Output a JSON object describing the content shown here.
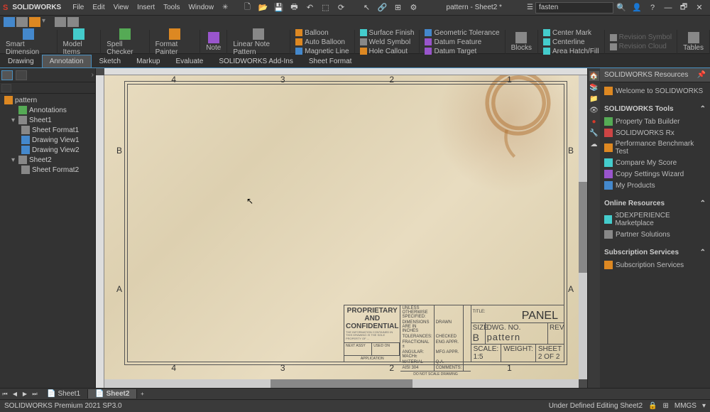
{
  "title": {
    "app": "SOLIDWORKS",
    "doc": "pattern - Sheet2 *"
  },
  "search": {
    "placeholder": "fasten"
  },
  "menu": [
    "File",
    "Edit",
    "View",
    "Insert",
    "Tools",
    "Window"
  ],
  "tabs": [
    "Drawing",
    "Annotation",
    "Sketch",
    "Markup",
    "Evaluate",
    "SOLIDWORKS Add-Ins",
    "Sheet Format"
  ],
  "activeTab": "Annotation",
  "ribbon": {
    "big": [
      {
        "label": "Smart Dimension"
      },
      {
        "label": "Model Items"
      },
      {
        "label": "Spell Checker"
      },
      {
        "label": "Format Painter"
      },
      {
        "label": "Note"
      },
      {
        "label": "Linear Note Pattern"
      }
    ],
    "col1": [
      "Balloon",
      "Auto Balloon",
      "Magnetic Line"
    ],
    "col2": [
      "Surface Finish",
      "Weld Symbol",
      "Hole Callout"
    ],
    "col3": [
      "Geometric Tolerance",
      "Datum Feature",
      "Datum Target"
    ],
    "blocks": "Blocks",
    "col4": [
      "Center Mark",
      "Centerline",
      "Area Hatch/Fill"
    ],
    "col5": [
      "Revision Symbol",
      "Revision Cloud"
    ],
    "tables": "Tables"
  },
  "tree": {
    "root": "pattern",
    "items": [
      {
        "label": "Annotations",
        "lvl": 1,
        "icon": "c-green"
      },
      {
        "label": "Sheet1",
        "lvl": 1,
        "icon": "c-gray",
        "expand": true
      },
      {
        "label": "Sheet Format1",
        "lvl": 2,
        "icon": "c-gray"
      },
      {
        "label": "Drawing View1",
        "lvl": 2,
        "icon": "c-blue"
      },
      {
        "label": "Drawing View2",
        "lvl": 2,
        "icon": "c-blue"
      },
      {
        "label": "Sheet2",
        "lvl": 1,
        "icon": "c-gray",
        "expand": true
      },
      {
        "label": "Sheet Format2",
        "lvl": 2,
        "icon": "c-gray"
      }
    ]
  },
  "zones": {
    "top": [
      "4",
      "3",
      "2",
      "1"
    ],
    "side": [
      "B",
      "A"
    ]
  },
  "titleblock": {
    "proprietary": "PROPRIETARY AND CONFIDENTIAL",
    "titleLabel": "TITLE:",
    "titleName": "PANEL",
    "sizeLabel": "SIZE",
    "sizeVal": "B",
    "dwgLabel": "DWG. NO.",
    "dwgVal": "pattern",
    "revLabel": "REV",
    "scale": "SCALE: 1:5",
    "weight": "WEIGHT:",
    "sheet": "SHEET 2 OF 2",
    "app": "APPLICATION",
    "donot": "DO NOT SCALE DRAWING"
  },
  "sheets": {
    "tabs": [
      "Sheet1",
      "Sheet2"
    ],
    "active": "Sheet2"
  },
  "rp": {
    "title": "SOLIDWORKS Resources",
    "welcome": "Welcome to SOLIDWORKS",
    "sec1": "SOLIDWORKS Tools",
    "tools": [
      "Property Tab Builder",
      "SOLIDWORKS Rx",
      "Performance Benchmark Test",
      "Compare My Score",
      "Copy Settings Wizard",
      "My Products"
    ],
    "sec2": "Online Resources",
    "online": [
      "3DEXPERIENCE Marketplace",
      "Partner Solutions"
    ],
    "sec3": "Subscription Services",
    "subs": [
      "Subscription Services"
    ]
  },
  "status": {
    "left": "SOLIDWORKS Premium 2021 SP3.0",
    "mid": "Under Defined   Editing Sheet2",
    "units": "MMGS"
  }
}
